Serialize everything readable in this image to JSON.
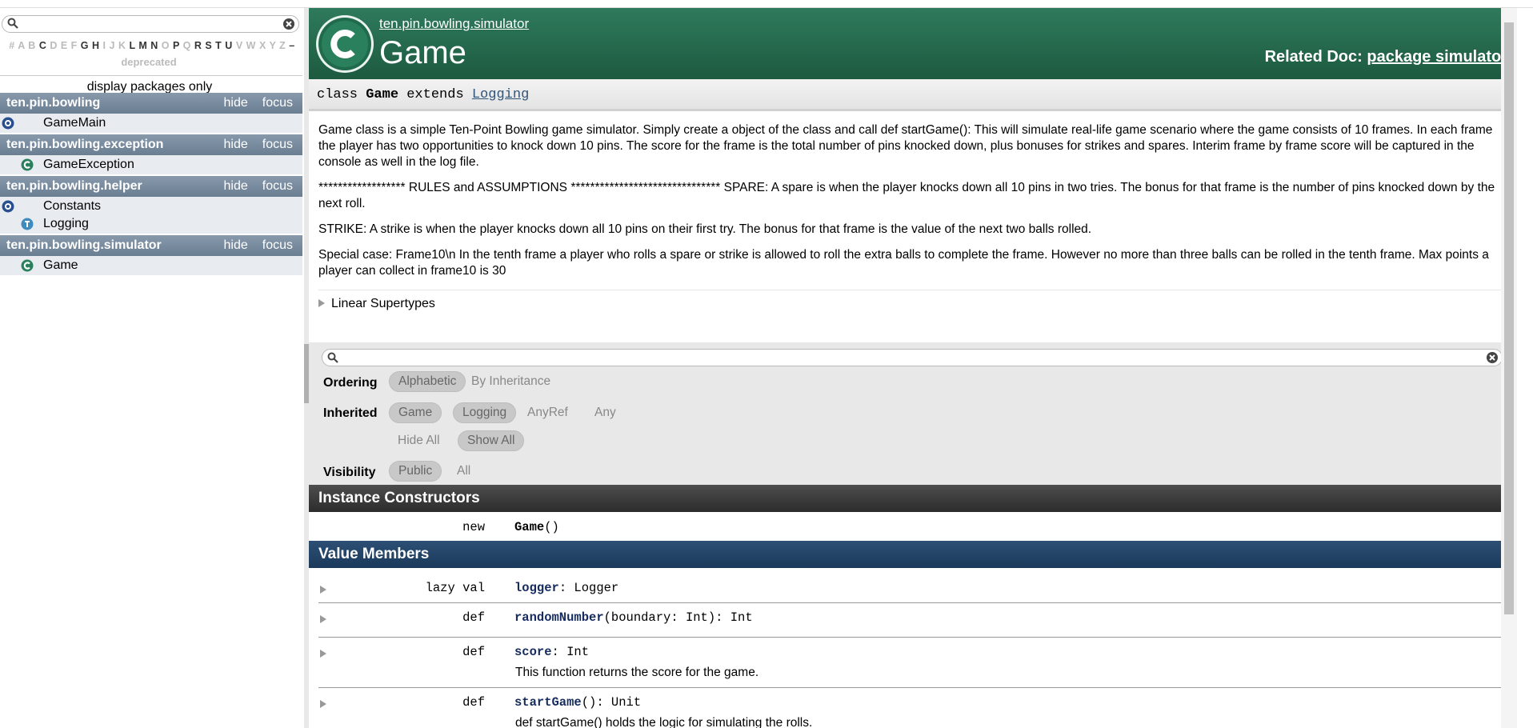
{
  "sidebar": {
    "letters": [
      {
        "ch": "#",
        "on": false
      },
      {
        "ch": "A",
        "on": false
      },
      {
        "ch": "B",
        "on": false
      },
      {
        "ch": "C",
        "on": true
      },
      {
        "ch": "D",
        "on": false
      },
      {
        "ch": "E",
        "on": false
      },
      {
        "ch": "F",
        "on": false
      },
      {
        "ch": "G",
        "on": true
      },
      {
        "ch": "H",
        "on": true
      },
      {
        "ch": "I",
        "on": false
      },
      {
        "ch": "J",
        "on": false
      },
      {
        "ch": "K",
        "on": false
      },
      {
        "ch": "L",
        "on": true
      },
      {
        "ch": "M",
        "on": true
      },
      {
        "ch": "N",
        "on": true
      },
      {
        "ch": "O",
        "on": false
      },
      {
        "ch": "P",
        "on": true
      },
      {
        "ch": "Q",
        "on": false
      },
      {
        "ch": "R",
        "on": true
      },
      {
        "ch": "S",
        "on": true
      },
      {
        "ch": "T",
        "on": true
      },
      {
        "ch": "U",
        "on": true
      },
      {
        "ch": "V",
        "on": false
      },
      {
        "ch": "W",
        "on": false
      },
      {
        "ch": "X",
        "on": false
      },
      {
        "ch": "Y",
        "on": false
      },
      {
        "ch": "Z",
        "on": false
      },
      {
        "ch": "–",
        "on": true
      }
    ],
    "deprecated": "deprecated",
    "display_packages": "display packages only",
    "hide_label": "hide",
    "focus_label": "focus",
    "packages": [
      {
        "name": "ten.pin.bowling",
        "entities": [
          {
            "kind": "object",
            "name": "GameMain"
          }
        ]
      },
      {
        "name": "ten.pin.bowling.exception",
        "entities": [
          {
            "kind": "class",
            "name": "GameException"
          }
        ]
      },
      {
        "name": "ten.pin.bowling.helper",
        "entities": [
          {
            "kind": "object",
            "name": "Constants"
          },
          {
            "kind": "trait",
            "name": "Logging"
          }
        ]
      },
      {
        "name": "ten.pin.bowling.simulator",
        "entities": [
          {
            "kind": "class",
            "name": "Game"
          }
        ]
      }
    ]
  },
  "header": {
    "package_path": "ten.pin.bowling.simulator",
    "title": "Game",
    "related_label": "Related Doc:",
    "related_link": "package simulator"
  },
  "signature": {
    "kw_class": "class",
    "name": "Game",
    "kw_extends": "extends",
    "parent": "Logging"
  },
  "comment": {
    "p1": "Game class is a simple Ten-Point Bowling game simulator. Simply create a object of the class and call def startGame(): This will simulate real-life game scenario where the game consists of 10 frames. In each frame the player has two opportunities to knock down 10 pins. The score for the frame is the total number of pins knocked down, plus bonuses for strikes and spares. Interim frame by frame score will be captured in the console as well in the log file.",
    "p2": "****************** RULES and ASSUMPTIONS ******************************* SPARE: A spare is when the player knocks down all 10 pins in two tries. The bonus for that frame is the number of pins knocked down by the next roll.",
    "p3": "STRIKE: A strike is when the player knocks down all 10 pins on their first try. The bonus for that frame is the value of the next two balls rolled.",
    "p4": "Special case: Frame10\\n In the tenth frame a player who rolls a spare or strike is allowed to roll the extra balls to complete the frame. However no more than three balls can be rolled in the tenth frame. Max points a player can collect in frame10 is 30",
    "linear_supertypes": "Linear Supertypes"
  },
  "filter": {
    "ordering_label": "Ordering",
    "ordering": [
      "Alphabetic",
      "By Inheritance"
    ],
    "inherited_label": "Inherited",
    "inherited": [
      "Game",
      "Logging",
      "AnyRef",
      "Any"
    ],
    "hide_all": "Hide All",
    "show_all": "Show All",
    "visibility_label": "Visibility",
    "visibility": [
      "Public",
      "All"
    ]
  },
  "constructors": {
    "title": "Instance Constructors",
    "items": [
      {
        "kw": "new",
        "name": "Game",
        "rest": "()"
      }
    ]
  },
  "values": {
    "title": "Value Members",
    "items": [
      {
        "kw": "lazy val",
        "name": "logger",
        "rest": ": Logger",
        "desc": ""
      },
      {
        "kw": "def",
        "name": "randomNumber",
        "rest": "(boundary: Int): Int",
        "desc": ""
      },
      {
        "kw": "def",
        "name": "score",
        "rest": ": Int",
        "desc": "This function returns the score for the game."
      },
      {
        "kw": "def",
        "name": "startGame",
        "rest": "(): Unit",
        "desc": "def startGame() holds the logic for simulating the rolls."
      }
    ]
  },
  "colors": {
    "header_green": "#2f7a5c",
    "package_bar": "#7a8ea2",
    "section_dark": "#3a3a3a",
    "section_blue": "#24466a"
  }
}
